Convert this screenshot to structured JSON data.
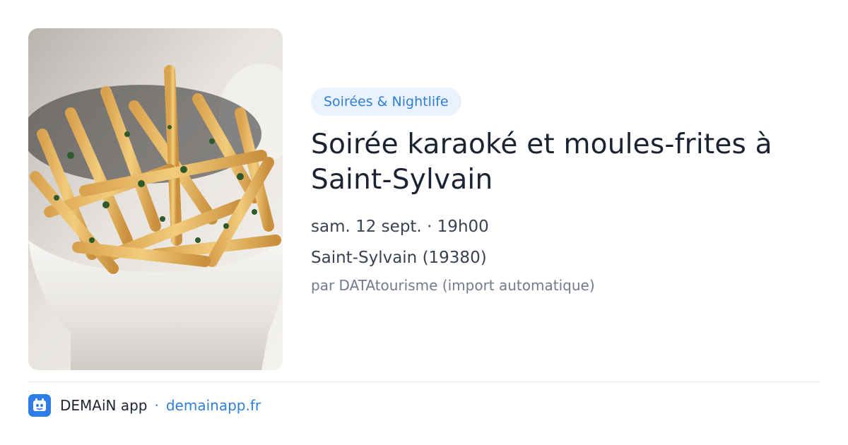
{
  "event": {
    "category_badge": "Soirées & Nightlife",
    "title": "Soirée karaoké et moules-frites à Saint-Sylvain",
    "date_time": "sam. 12 sept. · 19h00",
    "location": "Saint-Sylvain (19380)",
    "source": "par DATAtourisme (import automatique)"
  },
  "footer": {
    "app_name": "DEMAiN app",
    "separator": "·",
    "site": "demainapp.fr"
  },
  "colors": {
    "accent": "#2f7fd6",
    "badge_bg": "#eaf3fd",
    "app_icon_bg": "#2c7ee6"
  },
  "icons": {
    "app_logo": "demain-app-icon"
  }
}
